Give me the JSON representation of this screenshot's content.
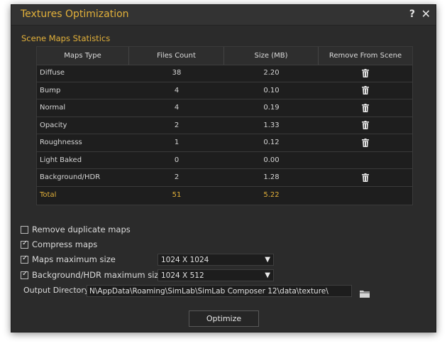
{
  "window": {
    "title": "Textures Optimization",
    "help_label": "?",
    "close_label": "✕"
  },
  "stats": {
    "section_title": "Scene Maps Statistics",
    "columns": [
      "Maps Type",
      "Files Count",
      "Size (MB)",
      "Remove From Scene"
    ],
    "rows": [
      {
        "type": "Diffuse",
        "count": "38",
        "size": "2.20"
      },
      {
        "type": "Bump",
        "count": "4",
        "size": "0.10"
      },
      {
        "type": "Normal",
        "count": "4",
        "size": "0.19"
      },
      {
        "type": "Opacity",
        "count": "2",
        "size": "1.33"
      },
      {
        "type": "Roughnesss",
        "count": "1",
        "size": "0.12"
      },
      {
        "type": "Light Baked",
        "count": "0",
        "size": "0.00"
      },
      {
        "type": "Background/HDR",
        "count": "2",
        "size": "1.28"
      }
    ],
    "total": {
      "type": "Total",
      "count": "51",
      "size": "5.22"
    },
    "remove_icon": "trash-icon"
  },
  "options": {
    "remove_duplicates": {
      "label": "Remove duplicate maps",
      "checked": false
    },
    "compress": {
      "label": "Compress maps",
      "checked": true
    },
    "maps_max": {
      "label": "Maps maximum size",
      "checked": true,
      "value": "1024 X 1024"
    },
    "bg_max": {
      "label": "Background/HDR maximum size",
      "checked": true,
      "value": "1024 X 512"
    }
  },
  "output": {
    "label": "Output Directory",
    "path": "N\\AppData\\Roaming\\SimLab\\SimLab Composer 12\\data\\texture\\",
    "browse_icon": "folder-icon"
  },
  "actions": {
    "optimize_label": "Optimize"
  },
  "colors": {
    "accent": "#e3b13a",
    "background": "#2b2b2b",
    "table_bg": "#1e1e1e"
  }
}
